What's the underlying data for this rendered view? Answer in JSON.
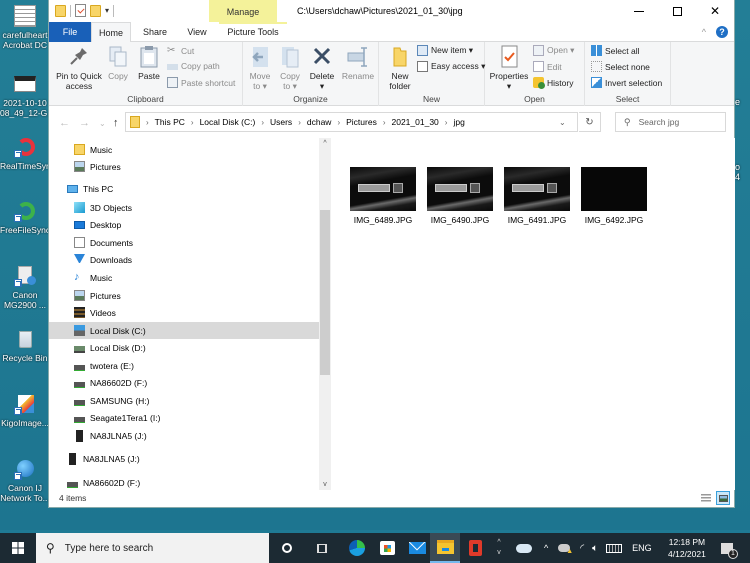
{
  "desktop": {
    "icons": [
      {
        "label1": "carefulheart",
        "label2": "Acrobat DC",
        "icon": "pdf-document-icon"
      },
      {
        "label1": "2021-10-10",
        "label2": "08_49_12-G...",
        "icon": "image-file-icon"
      },
      {
        "label1": "RealTimeSync",
        "label2": "",
        "icon": "realtimesync-icon"
      },
      {
        "label1": "FreeFileSync",
        "label2": "",
        "icon": "freefilesync-icon"
      },
      {
        "label1": "Canon",
        "label2": "MG2900 ...",
        "icon": "printer-icon"
      },
      {
        "label1": "Recycle Bin",
        "label2": "",
        "icon": "recycle-bin-icon"
      },
      {
        "label1": "KigoImage...",
        "label2": "",
        "icon": "kigoimage-icon"
      },
      {
        "label1": "Canon IJ",
        "label2": "Network To...",
        "icon": "network-tool-icon"
      }
    ],
    "right_fragments": [
      "e",
      "o",
      "4"
    ]
  },
  "window": {
    "title_path": "C:\\Users\\dchaw\\Pictures\\2021_01_30\\jpg",
    "context_tab": "Manage",
    "tabs": [
      "File",
      "Home",
      "Share",
      "View",
      "Picture Tools"
    ],
    "active_tab": "Home",
    "controls": {
      "minimize": "minimize",
      "maximize": "maximize",
      "close": "close"
    }
  },
  "ribbon": {
    "clipboard": {
      "label": "Clipboard",
      "pin": "Pin to Quick access",
      "pin1": "Pin to Quick",
      "pin2": "access",
      "copy": "Copy",
      "paste": "Paste",
      "cut": "Cut",
      "copy_path": "Copy path",
      "paste_shortcut": "Paste shortcut"
    },
    "organize": {
      "label": "Organize",
      "move1": "Move",
      "move2": "to ▾",
      "copy1": "Copy",
      "copy2": "to ▾",
      "delete": "Delete",
      "delete_arrow": "▾",
      "rename": "Rename"
    },
    "new": {
      "label": "New",
      "folder1": "New",
      "folder2": "folder",
      "new_item": "New item ▾",
      "easy_access": "Easy access ▾"
    },
    "open": {
      "label": "Open",
      "properties": "Properties",
      "properties_arrow": "▾",
      "open": "Open ▾",
      "edit": "Edit",
      "history": "History"
    },
    "select": {
      "label": "Select",
      "select_all": "Select all",
      "select_none": "Select none",
      "invert": "Invert selection"
    }
  },
  "address": {
    "crumbs": [
      "This PC",
      "Local Disk (C:)",
      "Users",
      "dchaw",
      "Pictures",
      "2021_01_30",
      "jpg"
    ],
    "search_placeholder": "Search jpg"
  },
  "nav": {
    "items": [
      {
        "label": "Music",
        "icon": "folder-icon",
        "indent": 1,
        "selected": false
      },
      {
        "label": "Pictures",
        "icon": "pictures-icon",
        "indent": 1,
        "selected": false
      },
      {
        "label": "This PC",
        "icon": "computer-icon",
        "indent": 0,
        "selected": false
      },
      {
        "label": "3D Objects",
        "icon": "3d-objects-icon",
        "indent": 1,
        "selected": false
      },
      {
        "label": "Desktop",
        "icon": "desktop-icon",
        "indent": 1,
        "selected": false
      },
      {
        "label": "Documents",
        "icon": "documents-icon",
        "indent": 1,
        "selected": false
      },
      {
        "label": "Downloads",
        "icon": "downloads-icon",
        "indent": 1,
        "selected": false
      },
      {
        "label": "Music",
        "icon": "music-icon",
        "indent": 1,
        "selected": false
      },
      {
        "label": "Pictures",
        "icon": "pictures-icon",
        "indent": 1,
        "selected": false
      },
      {
        "label": "Videos",
        "icon": "videos-icon",
        "indent": 1,
        "selected": false
      },
      {
        "label": "Local Disk (C:)",
        "icon": "system-drive-icon",
        "indent": 1,
        "selected": true
      },
      {
        "label": "Local Disk (D:)",
        "icon": "local-drive-icon",
        "indent": 1,
        "selected": false
      },
      {
        "label": "twotera (E:)",
        "icon": "drive-icon",
        "indent": 1,
        "selected": false
      },
      {
        "label": "NA86602D (F:)",
        "icon": "drive-icon",
        "indent": 1,
        "selected": false
      },
      {
        "label": "SAMSUNG (H:)",
        "icon": "drive-icon",
        "indent": 1,
        "selected": false
      },
      {
        "label": "Seagate1Tera1 (I:)",
        "icon": "drive-icon",
        "indent": 1,
        "selected": false
      },
      {
        "label": "NA8JLNA5 (J:)",
        "icon": "external-drive-icon",
        "indent": 1,
        "selected": false
      },
      {
        "label": "NA8JLNA5 (J:)",
        "icon": "external-drive-icon",
        "indent": 0,
        "selected": false
      },
      {
        "label": "NA86602D (F:)",
        "icon": "drive-icon",
        "indent": 0,
        "selected": false
      }
    ],
    "scroll_position": 0.37
  },
  "files": [
    {
      "name": "IMG_6489.JPG",
      "thumb": "plate"
    },
    {
      "name": "IMG_6490.JPG",
      "thumb": "plate"
    },
    {
      "name": "IMG_6491.JPG",
      "thumb": "plate"
    },
    {
      "name": "IMG_6492.JPG",
      "thumb": "dark"
    }
  ],
  "status": {
    "item_count": "4 items",
    "view_details": "details-view",
    "view_large": "large-icons-view"
  },
  "taskbar": {
    "search_placeholder": "Type here to search",
    "time": "12:18 PM",
    "date": "4/12/2021",
    "language": "ENG",
    "notification_count": "1"
  }
}
